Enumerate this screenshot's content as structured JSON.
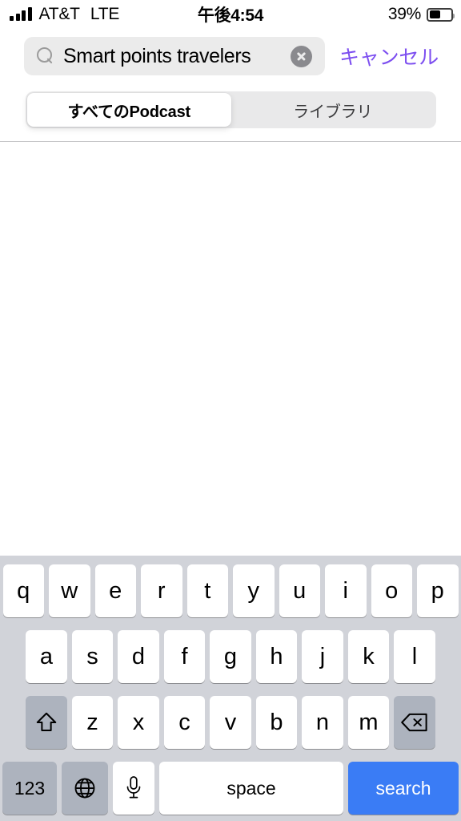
{
  "status_bar": {
    "signal_icon": "signal-bars-icon",
    "carrier": "AT&T",
    "radio": "LTE",
    "time": "午後4:54",
    "battery_percent": "39%",
    "battery_icon": "battery-icon"
  },
  "search": {
    "icon": "search-icon",
    "value": "Smart points travelers",
    "placeholder": "検索",
    "clear_icon": "clear-circle-icon",
    "cancel_label": "キャンセル",
    "cancel_color": "#7d4ff0"
  },
  "segmented_control": {
    "options": [
      {
        "label": "すべてのPodcast",
        "selected": true
      },
      {
        "label": "ライブラリ",
        "selected": false
      }
    ]
  },
  "keyboard": {
    "row1": [
      "q",
      "w",
      "e",
      "r",
      "t",
      "y",
      "u",
      "i",
      "o",
      "p"
    ],
    "row2": [
      "a",
      "s",
      "d",
      "f",
      "g",
      "h",
      "j",
      "k",
      "l"
    ],
    "row3": [
      "z",
      "x",
      "c",
      "v",
      "b",
      "n",
      "m"
    ],
    "shift_icon": "shift-icon",
    "backspace_icon": "backspace-icon",
    "numeric_label": "123",
    "globe_icon": "globe-icon",
    "dictation_icon": "microphone-icon",
    "space_label": "space",
    "return_label": "search",
    "return_color": "#3a7cf5"
  }
}
